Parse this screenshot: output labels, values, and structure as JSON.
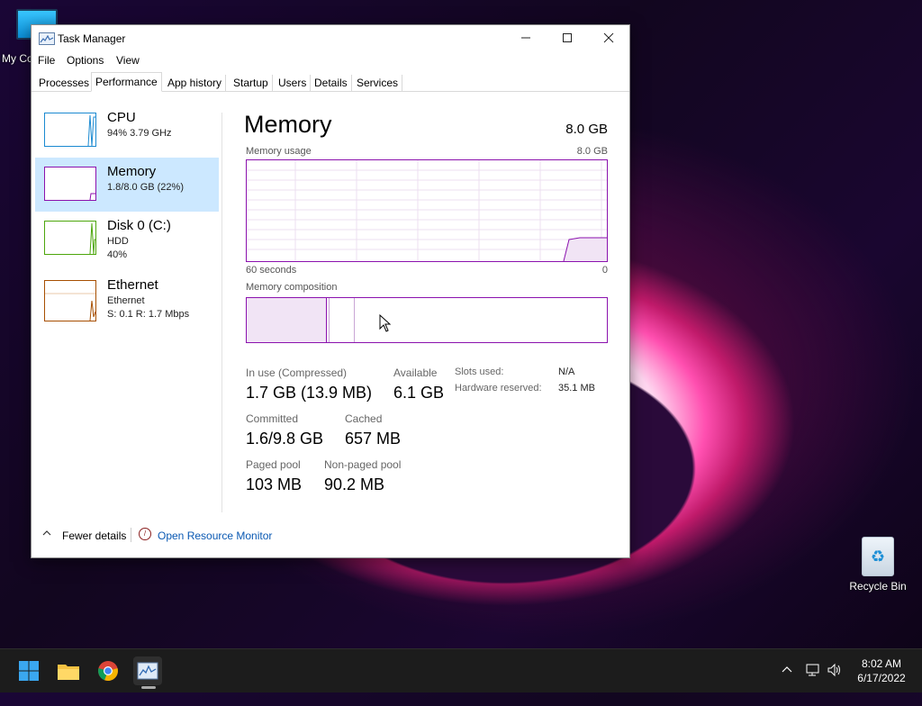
{
  "desktop": {
    "my_computer_label": "My Co",
    "recycle_bin_label": "Recycle Bin"
  },
  "window": {
    "title": "Task Manager",
    "menu": [
      "File",
      "Options",
      "View"
    ],
    "tabs": [
      "Processes",
      "Performance",
      "App history",
      "Startup",
      "Users",
      "Details",
      "Services"
    ],
    "active_tab": "Performance"
  },
  "sidebar": {
    "items": [
      {
        "title": "CPU",
        "sub1": "94%  3.79 GHz",
        "sub2": "",
        "color": "#1b8ad1"
      },
      {
        "title": "Memory",
        "sub1": "1.8/8.0 GB (22%)",
        "sub2": "",
        "color": "#8b12ae"
      },
      {
        "title": "Disk 0 (C:)",
        "sub1": "HDD",
        "sub2": "40%",
        "color": "#4da60c"
      },
      {
        "title": "Ethernet",
        "sub1": "Ethernet",
        "sub2": "S: 0.1  R: 1.7 Mbps",
        "color": "#a74f01"
      }
    ],
    "selected_index": 1
  },
  "memory": {
    "title": "Memory",
    "total": "8.0 GB",
    "usage_label": "Memory usage",
    "usage_max": "8.0 GB",
    "time_left": "60 seconds",
    "time_right": "0",
    "composition_label": "Memory composition",
    "stats": {
      "in_use_label": "In use (Compressed)",
      "in_use_value": "1.7 GB (13.9 MB)",
      "available_label": "Available",
      "available_value": "6.1 GB",
      "committed_label": "Committed",
      "committed_value": "1.6/9.8 GB",
      "cached_label": "Cached",
      "cached_value": "657 MB",
      "paged_label": "Paged pool",
      "paged_value": "103 MB",
      "nonpaged_label": "Non-paged pool",
      "nonpaged_value": "90.2 MB",
      "slots_label": "Slots used:",
      "slots_value": "N/A",
      "hw_reserved_label": "Hardware reserved:",
      "hw_reserved_value": "35.1 MB"
    }
  },
  "footer": {
    "fewer_details": "Fewer details",
    "open_resource_monitor": "Open Resource Monitor"
  },
  "taskbar": {
    "time": "8:02 AM",
    "date": "6/17/2022"
  }
}
